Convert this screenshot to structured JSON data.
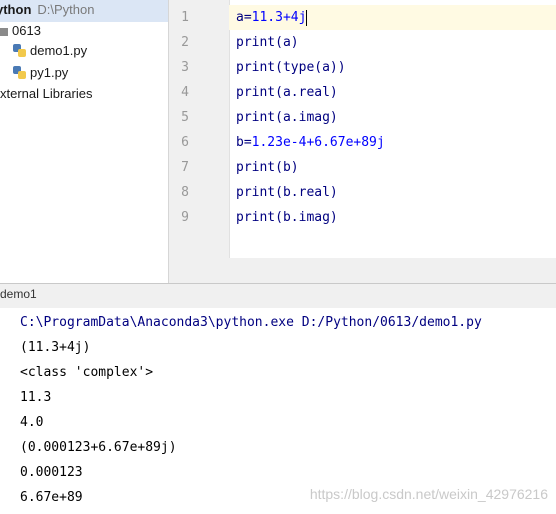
{
  "project": {
    "root_name": "ython",
    "root_path": "D:\\Python",
    "folder": "0613",
    "files": [
      "demo1.py",
      "py1.py"
    ],
    "external": "xternal Libraries"
  },
  "editor": {
    "line_numbers": [
      "1",
      "2",
      "3",
      "4",
      "5",
      "6",
      "7",
      "8",
      "9"
    ],
    "lines": [
      {
        "pre": "a=",
        "num": "11.3+4j",
        "post": ""
      },
      {
        "pre": "print(a)",
        "num": "",
        "post": ""
      },
      {
        "pre": "print(type(a))",
        "num": "",
        "post": ""
      },
      {
        "pre": "print(a.real)",
        "num": "",
        "post": ""
      },
      {
        "pre": "print(a.imag)",
        "num": "",
        "post": ""
      },
      {
        "pre": "b=",
        "num": "1.23e-4+6.67e+89j",
        "post": ""
      },
      {
        "pre": "print(b)",
        "num": "",
        "post": ""
      },
      {
        "pre": "print(b.real)",
        "num": "",
        "post": ""
      },
      {
        "pre": "print(b.imag)",
        "num": "",
        "post": ""
      }
    ]
  },
  "run": {
    "tab_label": "demo1",
    "command": "C:\\ProgramData\\Anaconda3\\python.exe D:/Python/0613/demo1.py",
    "output": [
      "(11.3+4j)",
      "<class 'complex'>",
      "11.3",
      "4.0",
      "(0.000123+6.67e+89j)",
      "0.000123",
      "6.67e+89"
    ]
  },
  "watermark": "https://blog.csdn.net/weixin_42976216",
  "colors": {
    "keyword_text": "#000080",
    "number": "#0000ff",
    "highlight_line": "#fffae3"
  }
}
